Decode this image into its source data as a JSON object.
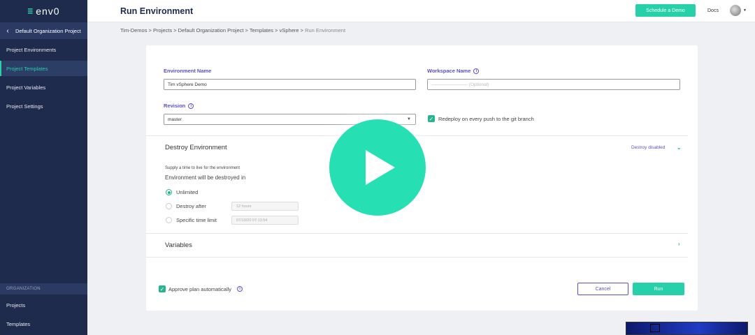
{
  "app": {
    "logo_text": "env0",
    "logo_mark": "≡"
  },
  "sidebar": {
    "org_header": "Default Organization Project",
    "items": [
      {
        "label": "Project Environments",
        "active": false
      },
      {
        "label": "Project Templates",
        "active": true
      },
      {
        "label": "Project Variables",
        "active": false
      },
      {
        "label": "Project Settings",
        "active": false
      }
    ],
    "section_label": "ORGANIZATION",
    "org_items": [
      {
        "label": "Projects"
      },
      {
        "label": "Templates"
      }
    ]
  },
  "header": {
    "title": "Run Environment",
    "schedule_label": "Schedule a Demo",
    "docs_label": "Docs"
  },
  "breadcrumb": {
    "path": "Tim-Demos > Projects > Default Organization Project > Templates > vSphere > ",
    "current": "Run Environment"
  },
  "form": {
    "env_name_label": "Environment Name",
    "env_name_value": "Tim vSphere Demo",
    "workspace_label": "Workspace Name",
    "workspace_placeholder": "———————— (Optional)",
    "revision_label": "Revision",
    "revision_value": "master",
    "redeploy_label": "Redeploy on every push to the git branch",
    "redeploy_checked": true
  },
  "destroy": {
    "title": "Destroy Environment",
    "status": "Destroy disabled",
    "hint": "Supply a time to live for the environment",
    "subtitle": "Environment will be destroyed in",
    "options": [
      {
        "label": "Unlimited",
        "selected": true
      },
      {
        "label": "Destroy after",
        "selected": false,
        "value": "12 hours"
      },
      {
        "label": "Specific time limit",
        "selected": false,
        "value": "07/10/20 07:13:54"
      }
    ]
  },
  "variables": {
    "title": "Variables"
  },
  "footer": {
    "approve_label": "Approve plan automatically",
    "approve_checked": true,
    "cancel_label": "Cancel",
    "run_label": "Run"
  },
  "colors": {
    "sidebar_bg": "#1f2b4d",
    "accent": "#26d0a8",
    "label_purple": "#5b4fc7"
  }
}
